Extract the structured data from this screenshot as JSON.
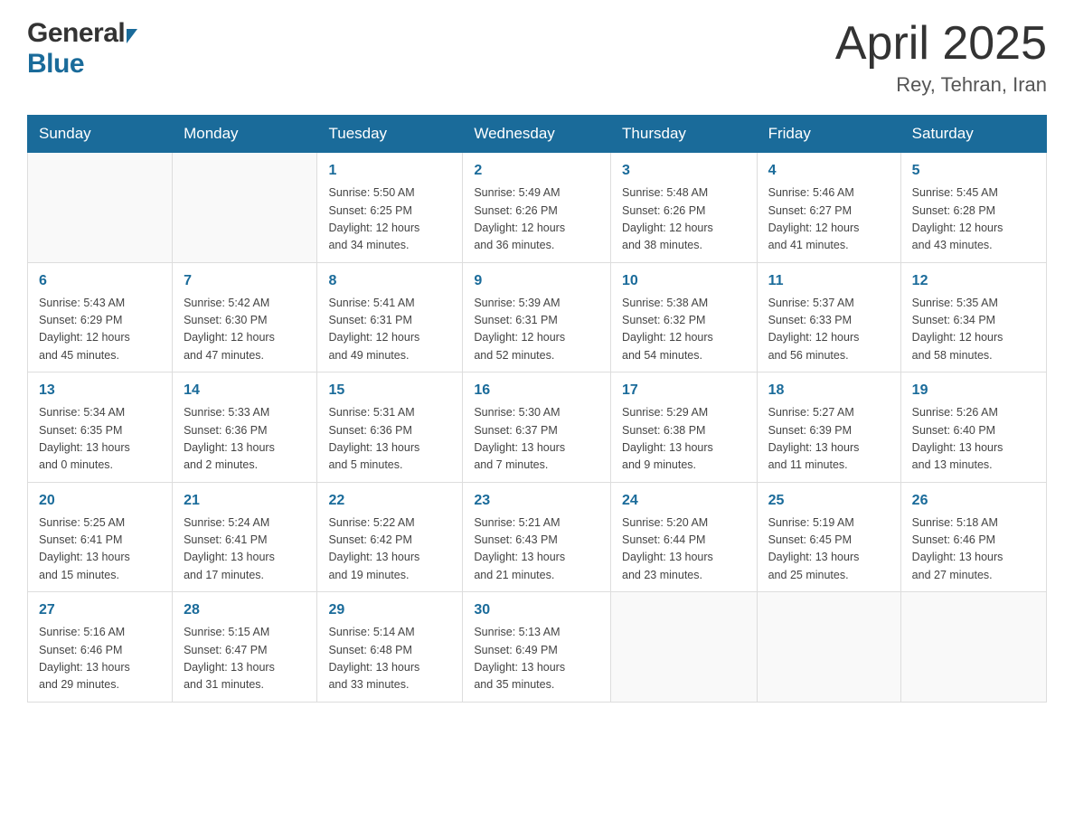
{
  "header": {
    "logo_general": "General",
    "logo_blue": "Blue",
    "title": "April 2025",
    "subtitle": "Rey, Tehran, Iran"
  },
  "days_of_week": [
    "Sunday",
    "Monday",
    "Tuesday",
    "Wednesday",
    "Thursday",
    "Friday",
    "Saturday"
  ],
  "weeks": [
    [
      {
        "day": "",
        "info": ""
      },
      {
        "day": "",
        "info": ""
      },
      {
        "day": "1",
        "info": "Sunrise: 5:50 AM\nSunset: 6:25 PM\nDaylight: 12 hours\nand 34 minutes."
      },
      {
        "day": "2",
        "info": "Sunrise: 5:49 AM\nSunset: 6:26 PM\nDaylight: 12 hours\nand 36 minutes."
      },
      {
        "day": "3",
        "info": "Sunrise: 5:48 AM\nSunset: 6:26 PM\nDaylight: 12 hours\nand 38 minutes."
      },
      {
        "day": "4",
        "info": "Sunrise: 5:46 AM\nSunset: 6:27 PM\nDaylight: 12 hours\nand 41 minutes."
      },
      {
        "day": "5",
        "info": "Sunrise: 5:45 AM\nSunset: 6:28 PM\nDaylight: 12 hours\nand 43 minutes."
      }
    ],
    [
      {
        "day": "6",
        "info": "Sunrise: 5:43 AM\nSunset: 6:29 PM\nDaylight: 12 hours\nand 45 minutes."
      },
      {
        "day": "7",
        "info": "Sunrise: 5:42 AM\nSunset: 6:30 PM\nDaylight: 12 hours\nand 47 minutes."
      },
      {
        "day": "8",
        "info": "Sunrise: 5:41 AM\nSunset: 6:31 PM\nDaylight: 12 hours\nand 49 minutes."
      },
      {
        "day": "9",
        "info": "Sunrise: 5:39 AM\nSunset: 6:31 PM\nDaylight: 12 hours\nand 52 minutes."
      },
      {
        "day": "10",
        "info": "Sunrise: 5:38 AM\nSunset: 6:32 PM\nDaylight: 12 hours\nand 54 minutes."
      },
      {
        "day": "11",
        "info": "Sunrise: 5:37 AM\nSunset: 6:33 PM\nDaylight: 12 hours\nand 56 minutes."
      },
      {
        "day": "12",
        "info": "Sunrise: 5:35 AM\nSunset: 6:34 PM\nDaylight: 12 hours\nand 58 minutes."
      }
    ],
    [
      {
        "day": "13",
        "info": "Sunrise: 5:34 AM\nSunset: 6:35 PM\nDaylight: 13 hours\nand 0 minutes."
      },
      {
        "day": "14",
        "info": "Sunrise: 5:33 AM\nSunset: 6:36 PM\nDaylight: 13 hours\nand 2 minutes."
      },
      {
        "day": "15",
        "info": "Sunrise: 5:31 AM\nSunset: 6:36 PM\nDaylight: 13 hours\nand 5 minutes."
      },
      {
        "day": "16",
        "info": "Sunrise: 5:30 AM\nSunset: 6:37 PM\nDaylight: 13 hours\nand 7 minutes."
      },
      {
        "day": "17",
        "info": "Sunrise: 5:29 AM\nSunset: 6:38 PM\nDaylight: 13 hours\nand 9 minutes."
      },
      {
        "day": "18",
        "info": "Sunrise: 5:27 AM\nSunset: 6:39 PM\nDaylight: 13 hours\nand 11 minutes."
      },
      {
        "day": "19",
        "info": "Sunrise: 5:26 AM\nSunset: 6:40 PM\nDaylight: 13 hours\nand 13 minutes."
      }
    ],
    [
      {
        "day": "20",
        "info": "Sunrise: 5:25 AM\nSunset: 6:41 PM\nDaylight: 13 hours\nand 15 minutes."
      },
      {
        "day": "21",
        "info": "Sunrise: 5:24 AM\nSunset: 6:41 PM\nDaylight: 13 hours\nand 17 minutes."
      },
      {
        "day": "22",
        "info": "Sunrise: 5:22 AM\nSunset: 6:42 PM\nDaylight: 13 hours\nand 19 minutes."
      },
      {
        "day": "23",
        "info": "Sunrise: 5:21 AM\nSunset: 6:43 PM\nDaylight: 13 hours\nand 21 minutes."
      },
      {
        "day": "24",
        "info": "Sunrise: 5:20 AM\nSunset: 6:44 PM\nDaylight: 13 hours\nand 23 minutes."
      },
      {
        "day": "25",
        "info": "Sunrise: 5:19 AM\nSunset: 6:45 PM\nDaylight: 13 hours\nand 25 minutes."
      },
      {
        "day": "26",
        "info": "Sunrise: 5:18 AM\nSunset: 6:46 PM\nDaylight: 13 hours\nand 27 minutes."
      }
    ],
    [
      {
        "day": "27",
        "info": "Sunrise: 5:16 AM\nSunset: 6:46 PM\nDaylight: 13 hours\nand 29 minutes."
      },
      {
        "day": "28",
        "info": "Sunrise: 5:15 AM\nSunset: 6:47 PM\nDaylight: 13 hours\nand 31 minutes."
      },
      {
        "day": "29",
        "info": "Sunrise: 5:14 AM\nSunset: 6:48 PM\nDaylight: 13 hours\nand 33 minutes."
      },
      {
        "day": "30",
        "info": "Sunrise: 5:13 AM\nSunset: 6:49 PM\nDaylight: 13 hours\nand 35 minutes."
      },
      {
        "day": "",
        "info": ""
      },
      {
        "day": "",
        "info": ""
      },
      {
        "day": "",
        "info": ""
      }
    ]
  ]
}
